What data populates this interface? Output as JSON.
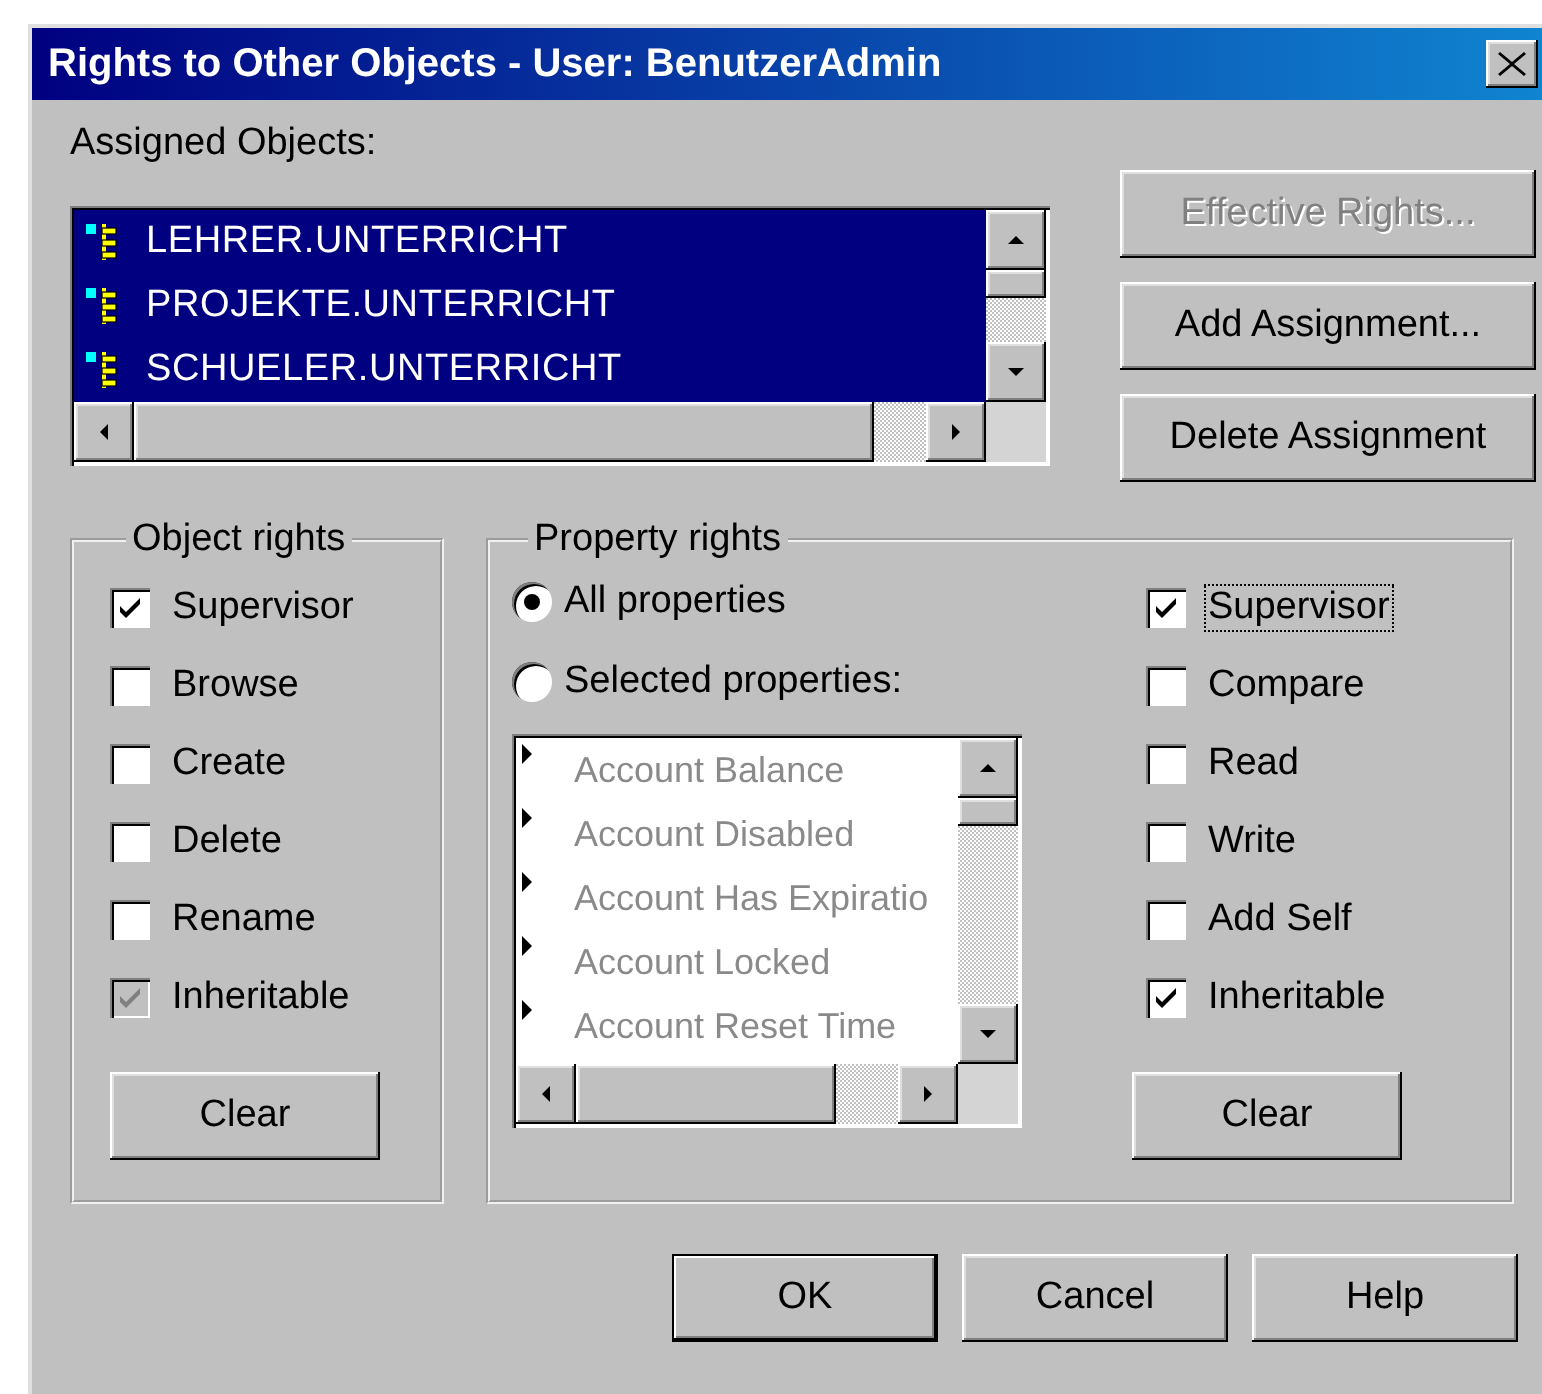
{
  "window": {
    "title": "Rights to Other Objects - User: BenutzerAdmin"
  },
  "assigned_objects": {
    "label": "Assigned Objects:",
    "items": [
      {
        "name": "LEHRER.UNTERRICHT",
        "selected": true
      },
      {
        "name": "PROJEKTE.UNTERRICHT",
        "selected": true
      },
      {
        "name": "SCHUELER.UNTERRICHT",
        "selected": true
      }
    ]
  },
  "action_buttons": [
    {
      "label": "Effective Rights...",
      "disabled": true
    },
    {
      "label": "Add Assignment...",
      "disabled": false
    },
    {
      "label": "Delete Assignment",
      "disabled": false
    }
  ],
  "object_rights": {
    "title": "Object rights",
    "options": [
      {
        "label": "Supervisor",
        "checked": true,
        "disabled": false
      },
      {
        "label": "Browse",
        "checked": false,
        "disabled": false
      },
      {
        "label": "Create",
        "checked": false,
        "disabled": false
      },
      {
        "label": "Delete",
        "checked": false,
        "disabled": false
      },
      {
        "label": "Rename",
        "checked": false,
        "disabled": false
      },
      {
        "label": "Inheritable",
        "checked": true,
        "disabled": true
      }
    ],
    "clear_button": "Clear"
  },
  "property_rights": {
    "title": "Property rights",
    "scope": [
      {
        "label": "All properties",
        "selected": true
      },
      {
        "label": "Selected properties:",
        "selected": false
      }
    ],
    "properties": [
      {
        "name": "Account Balance",
        "disabled": true
      },
      {
        "name": "Account Disabled",
        "disabled": true
      },
      {
        "name": "Account Has Expiratio",
        "disabled": true
      },
      {
        "name": "Account Locked",
        "disabled": true
      },
      {
        "name": "Account Reset Time",
        "disabled": true
      }
    ],
    "options": [
      {
        "label": "Supervisor",
        "checked": true,
        "focused": true
      },
      {
        "label": "Compare",
        "checked": false,
        "focused": false
      },
      {
        "label": "Read",
        "checked": false,
        "focused": false
      },
      {
        "label": "Write",
        "checked": false,
        "focused": false
      },
      {
        "label": "Add Self",
        "checked": false,
        "focused": false
      },
      {
        "label": "Inheritable",
        "checked": true,
        "focused": false
      }
    ],
    "clear_button": "Clear"
  },
  "dialog_buttons": [
    {
      "label": "OK",
      "default": true
    },
    {
      "label": "Cancel",
      "default": false
    },
    {
      "label": "Help",
      "default": false
    }
  ]
}
